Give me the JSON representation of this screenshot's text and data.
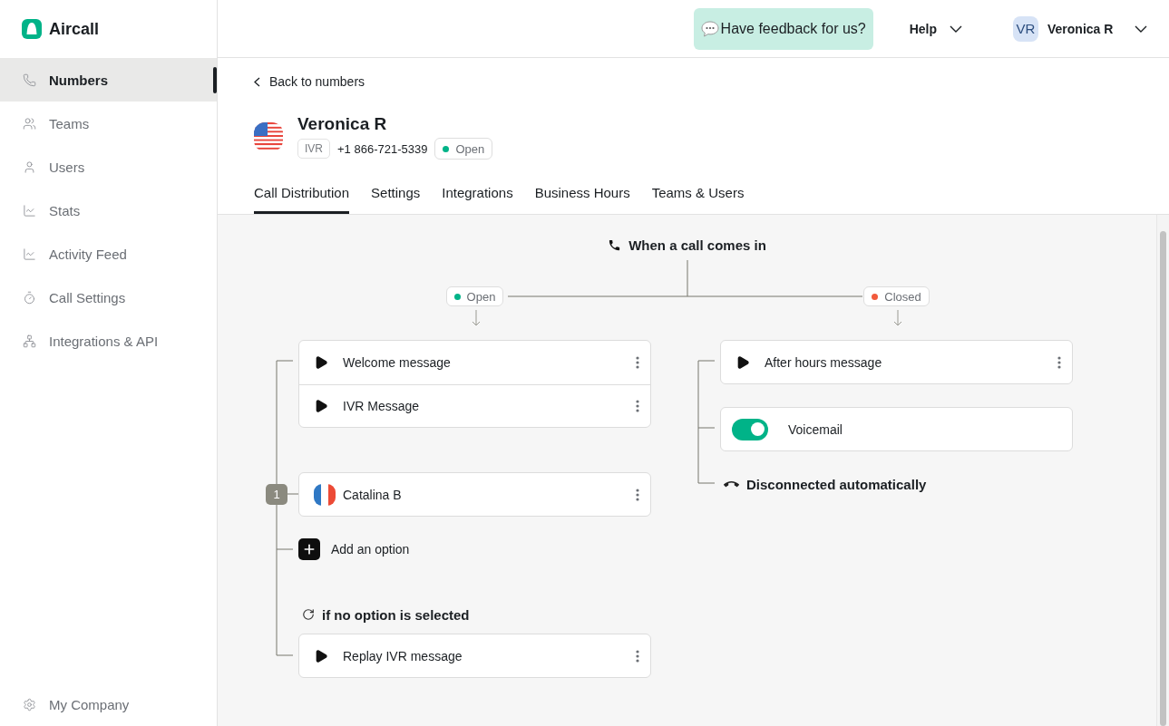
{
  "brand": "Aircall",
  "sidebar": {
    "items": [
      {
        "label": "Numbers",
        "selected": true
      },
      {
        "label": "Teams",
        "selected": false
      },
      {
        "label": "Users",
        "selected": false
      },
      {
        "label": "Stats",
        "selected": false
      },
      {
        "label": "Activity Feed",
        "selected": false
      },
      {
        "label": "Call Settings",
        "selected": false
      },
      {
        "label": "Integrations & API",
        "selected": false
      }
    ],
    "footer": {
      "label": "My Company"
    }
  },
  "topbar": {
    "feedback": "Have feedback for us?",
    "help": "Help",
    "user": {
      "initials": "VR",
      "name": "Veronica R"
    }
  },
  "number": {
    "back": "Back to numbers",
    "name": "Veronica R",
    "type": "IVR",
    "phone": "+1 866-721-5339",
    "status": {
      "label": "Open",
      "color": "#00b388"
    }
  },
  "tabs": [
    {
      "label": "Call Distribution",
      "selected": true
    },
    {
      "label": "Settings",
      "selected": false
    },
    {
      "label": "Integrations",
      "selected": false
    },
    {
      "label": "Business Hours",
      "selected": false
    },
    {
      "label": "Teams & Users",
      "selected": false
    }
  ],
  "flow": {
    "title": "When a call comes in",
    "branches": [
      {
        "label": "Open",
        "color": "#00b388",
        "items": [
          {
            "kind": "message_group",
            "messages": [
              "Welcome message",
              "IVR Message"
            ]
          },
          {
            "kind": "option",
            "key": "1",
            "label": "Catalina B"
          },
          {
            "kind": "add",
            "label": "Add an option"
          },
          {
            "kind": "note",
            "label": "if no option is selected"
          },
          {
            "kind": "message",
            "label": "Replay IVR message"
          }
        ]
      },
      {
        "label": "Closed",
        "color": "#f25a3c",
        "items": [
          {
            "kind": "message",
            "label": "After hours message"
          },
          {
            "kind": "toggle",
            "label": "Voicemail",
            "on": true
          },
          {
            "kind": "end",
            "label": "Disconnected automatically"
          }
        ]
      }
    ]
  }
}
